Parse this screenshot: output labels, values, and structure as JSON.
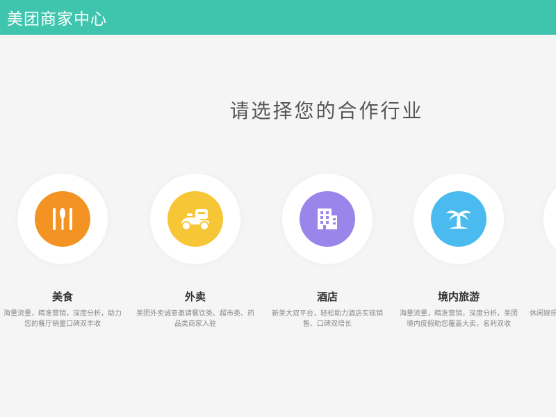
{
  "header": {
    "brand": "美团商家中心",
    "bg_color": "#3fc5ae"
  },
  "main": {
    "title": "请选择您的合作行业",
    "industries": [
      {
        "name": "美食",
        "icon": "fork-knife-icon",
        "color": "#f39323",
        "desc": "海量流量，精准营销，深度分析，助力您的餐厅销量口碑双丰收"
      },
      {
        "name": "外卖",
        "icon": "delivery-scooter-icon",
        "color": "#f7c637",
        "desc": "美团外卖诚意邀请餐饮类、超市类、药品类商家入驻"
      },
      {
        "name": "酒店",
        "icon": "hotel-building-icon",
        "color": "#9a85ea",
        "desc": "新美大双平台，轻松助力酒店实现销售、口碑双增长"
      },
      {
        "name": "境内旅游",
        "icon": "palm-tree-icon",
        "color": "#4bbbef",
        "desc": "海量流量，精准营销，深度分析，美团境内度假助您覆盖大卖，名利双收"
      },
      {
        "name": "",
        "icon": "",
        "color": "#ffffff",
        "desc": "休闲娱乐，尽享好生活"
      }
    ]
  }
}
